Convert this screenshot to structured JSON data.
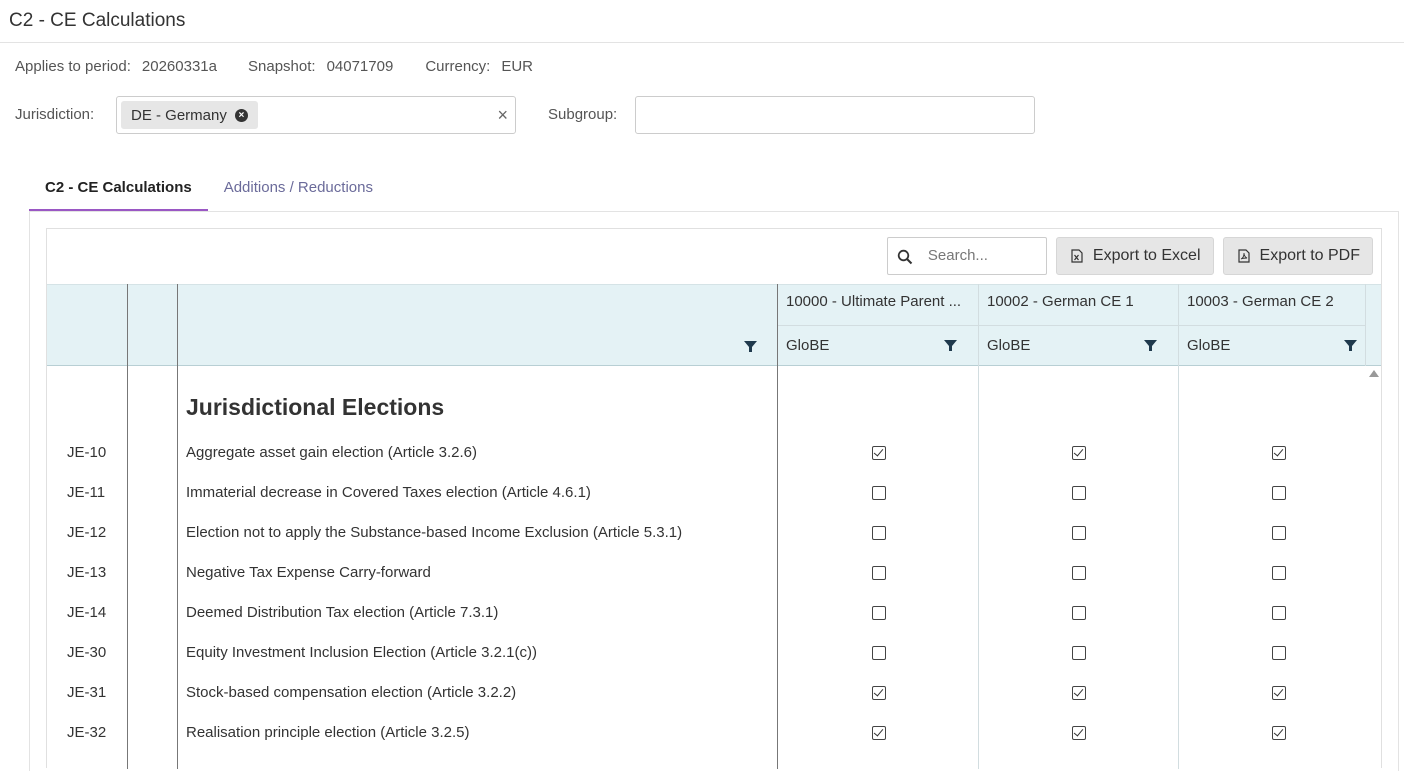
{
  "page": {
    "title": "C2 - CE Calculations"
  },
  "meta": {
    "period_label": "Applies to period:",
    "period_value": "20260331a",
    "snapshot_label": "Snapshot:",
    "snapshot_value": "04071709",
    "currency_label": "Currency:",
    "currency_value": "EUR"
  },
  "filters": {
    "jurisdiction_label": "Jurisdiction:",
    "jurisdiction_chip": "DE - Germany",
    "clear_symbol": "×",
    "subgroup_label": "Subgroup:",
    "subgroup_value": ""
  },
  "tabs": [
    {
      "label": "C2 - CE Calculations",
      "active": true
    },
    {
      "label": "Additions / Reductions",
      "active": false
    }
  ],
  "toolbar": {
    "search_placeholder": "Search...",
    "export_excel": "Export to Excel",
    "export_pdf": "Export to PDF"
  },
  "columns": [
    {
      "entity": "10000 - Ultimate Parent ...",
      "basis": "GloBE"
    },
    {
      "entity": "10002 - German CE 1",
      "basis": "GloBE"
    },
    {
      "entity": "10003 - German CE 2",
      "basis": "GloBE"
    }
  ],
  "section": {
    "title": "Jurisdictional Elections"
  },
  "rows": [
    {
      "code": "JE-10",
      "desc": "Aggregate asset gain election (Article 3.2.6)",
      "values": [
        true,
        true,
        true
      ]
    },
    {
      "code": "JE-11",
      "desc": "Immaterial decrease in Covered Taxes election (Article 4.6.1)",
      "values": [
        false,
        false,
        false
      ]
    },
    {
      "code": "JE-12",
      "desc": "Election not to apply the Substance-based Income Exclusion (Article 5.3.1)",
      "values": [
        false,
        false,
        false
      ]
    },
    {
      "code": "JE-13",
      "desc": "Negative Tax Expense Carry-forward",
      "values": [
        false,
        false,
        false
      ]
    },
    {
      "code": "JE-14",
      "desc": "Deemed Distribution Tax election (Article 7.3.1)",
      "values": [
        false,
        false,
        false
      ]
    },
    {
      "code": "JE-30",
      "desc": "Equity Investment Inclusion Election (Article 3.2.1(c))",
      "values": [
        false,
        false,
        false
      ]
    },
    {
      "code": "JE-31",
      "desc": "Stock-based compensation election (Article 3.2.2)",
      "values": [
        true,
        true,
        true
      ]
    },
    {
      "code": "JE-32",
      "desc": "Realisation principle election (Article 3.2.5)",
      "values": [
        true,
        true,
        true
      ]
    }
  ],
  "colors": {
    "accent": "#9a57c4",
    "header_bg": "#e4f2f5",
    "funnel": "#1f3a4d"
  }
}
